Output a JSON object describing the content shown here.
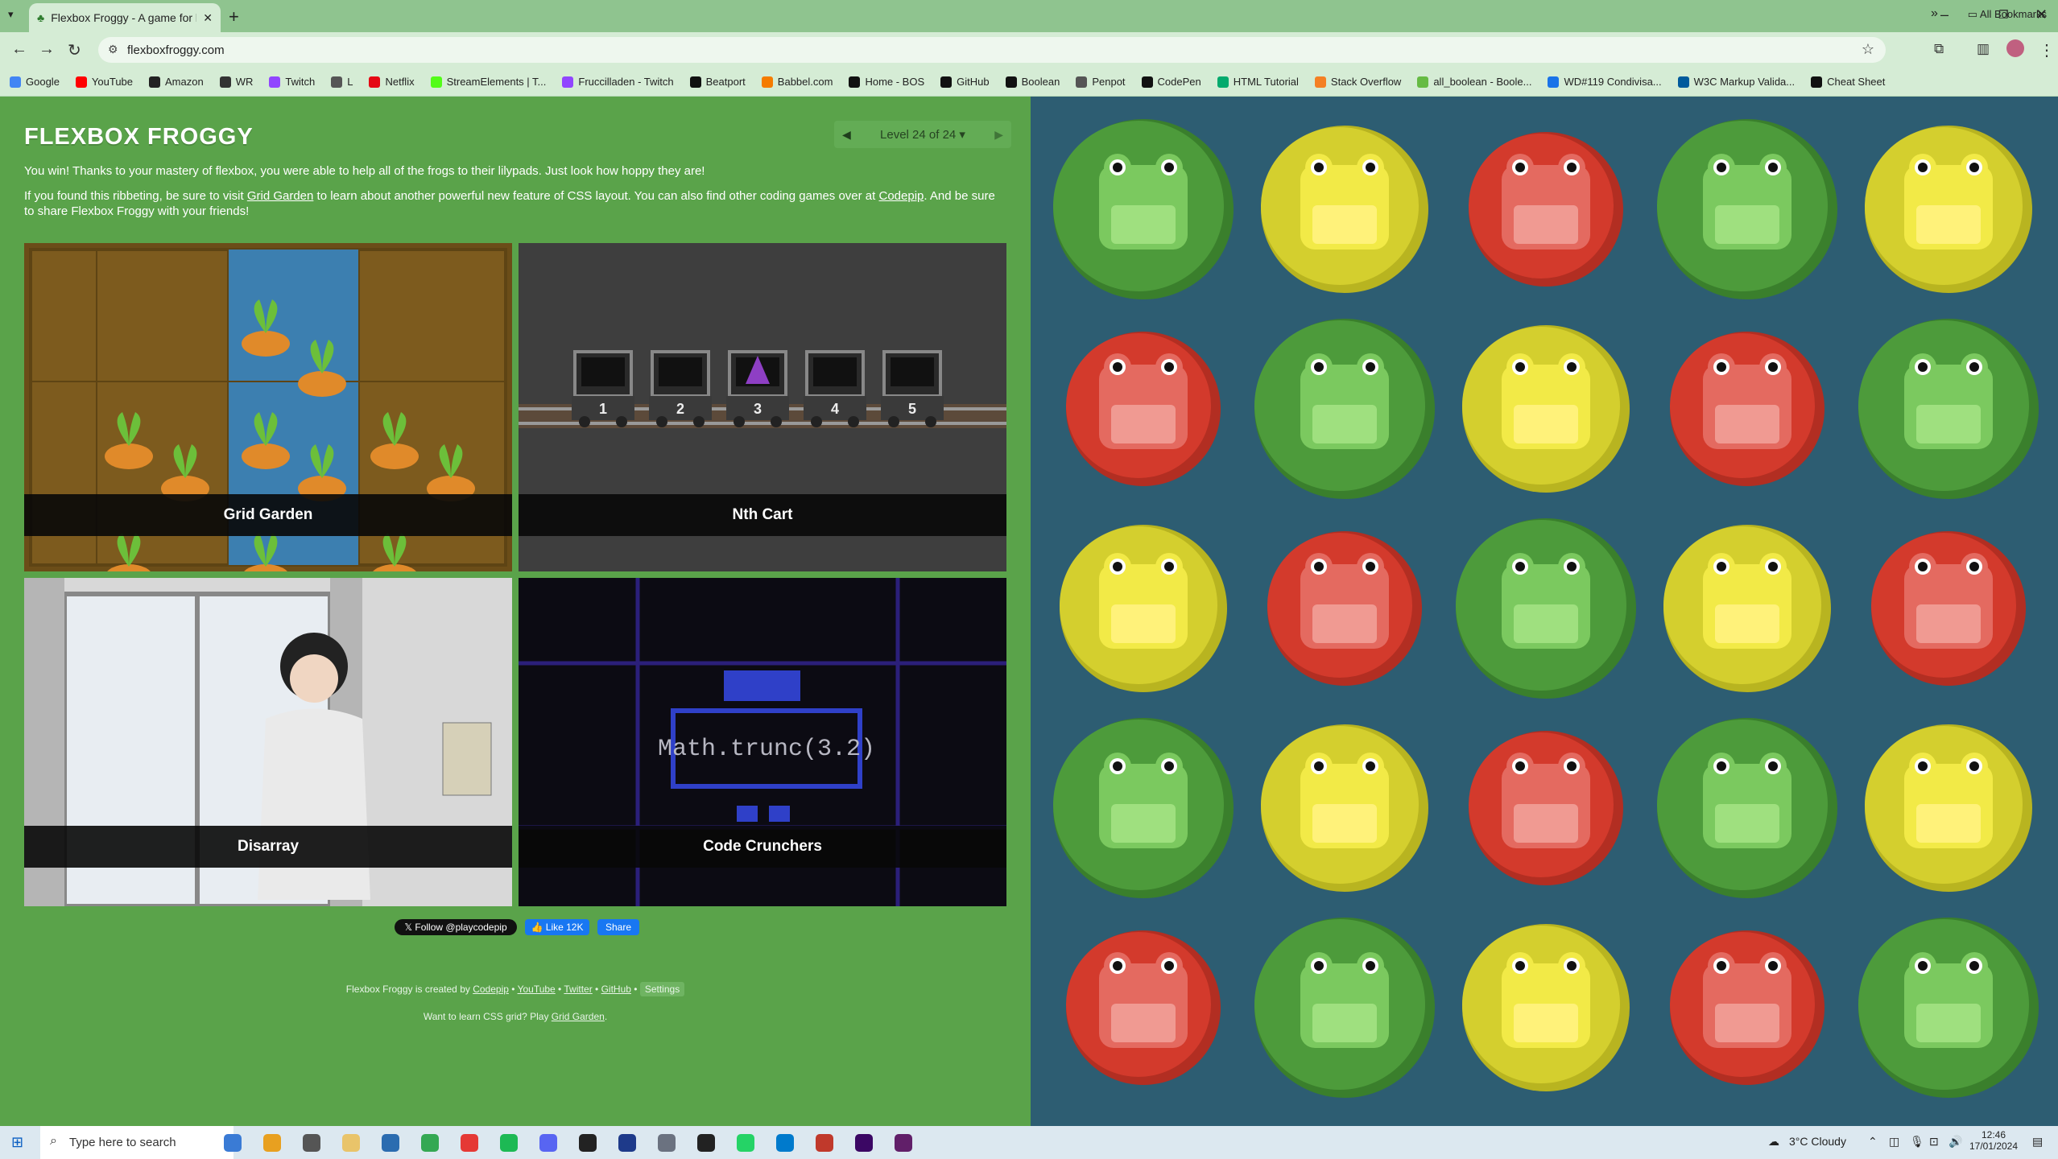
{
  "browser": {
    "tab_title": "Flexbox Froggy - A game for le",
    "url": "flexboxfroggy.com",
    "bookmarks": [
      "Google",
      "YouTube",
      "Amazon",
      "WR",
      "Twitch",
      "L",
      "Netflix",
      "StreamElements | T...",
      "Fruccilladen - Twitch",
      "Beatport",
      "Babbel.com",
      "Home - BOS",
      "GitHub",
      "Boolean",
      "Penpot",
      "CodePen",
      "HTML Tutorial",
      "Stack Overflow",
      "all_boolean - Boole...",
      "WD#119 Condivisa...",
      "W3C Markup Valida...",
      "Cheat Sheet"
    ],
    "all_bookmarks": "All Bookmarks"
  },
  "page": {
    "logo": "FLEXBOX FROGGY",
    "level": "Level 24 of 24",
    "win_text": "You win! Thanks to your mastery of flexbox, you were able to help all of the frogs to their lilypads. Just look how hoppy they are!",
    "p2_a": "If you found this ribbeting, be sure to visit ",
    "p2_link1": "Grid Garden",
    "p2_b": " to learn about another powerful new feature of CSS layout. You can also find other coding games over at ",
    "p2_link2": "Codepip",
    "p2_c": ". And be sure to share Flexbox Froggy with your friends!",
    "cards": [
      "Grid Garden",
      "Nth Cart",
      "Disarray",
      "Code Crunchers"
    ],
    "cart_numbers": [
      "1",
      "2",
      "3",
      "4",
      "5"
    ],
    "code_text": "Math.trunc(3.2)",
    "follow": "Follow @playcodepip",
    "like": "Like 12K",
    "share": "Share",
    "footer_prefix": "Flexbox Froggy is created by ",
    "footer_links": [
      "Codepip",
      "YouTube",
      "Twitter",
      "GitHub"
    ],
    "settings": "Settings",
    "footer2_prefix": "Want to learn CSS grid? Play ",
    "footer2_link": "Grid Garden",
    "footer2_suffix": "."
  },
  "frogs": [
    [
      "green",
      "yellow",
      "red",
      "green",
      "yellow"
    ],
    [
      "red",
      "green",
      "yellow",
      "red",
      "green"
    ],
    [
      "yellow",
      "red",
      "green",
      "yellow",
      "red"
    ],
    [
      "green",
      "yellow",
      "red",
      "green",
      "yellow"
    ],
    [
      "red",
      "green",
      "yellow",
      "red",
      "green"
    ]
  ],
  "colors": {
    "green": "#4d9b3b",
    "yellow": "#d4cf2e",
    "red": "#d33a2c",
    "water": "#2d5d72"
  },
  "taskbar": {
    "search_placeholder": "Type here to search",
    "weather": "3°C  Cloudy",
    "time": "12:46",
    "date": "17/01/2024"
  }
}
